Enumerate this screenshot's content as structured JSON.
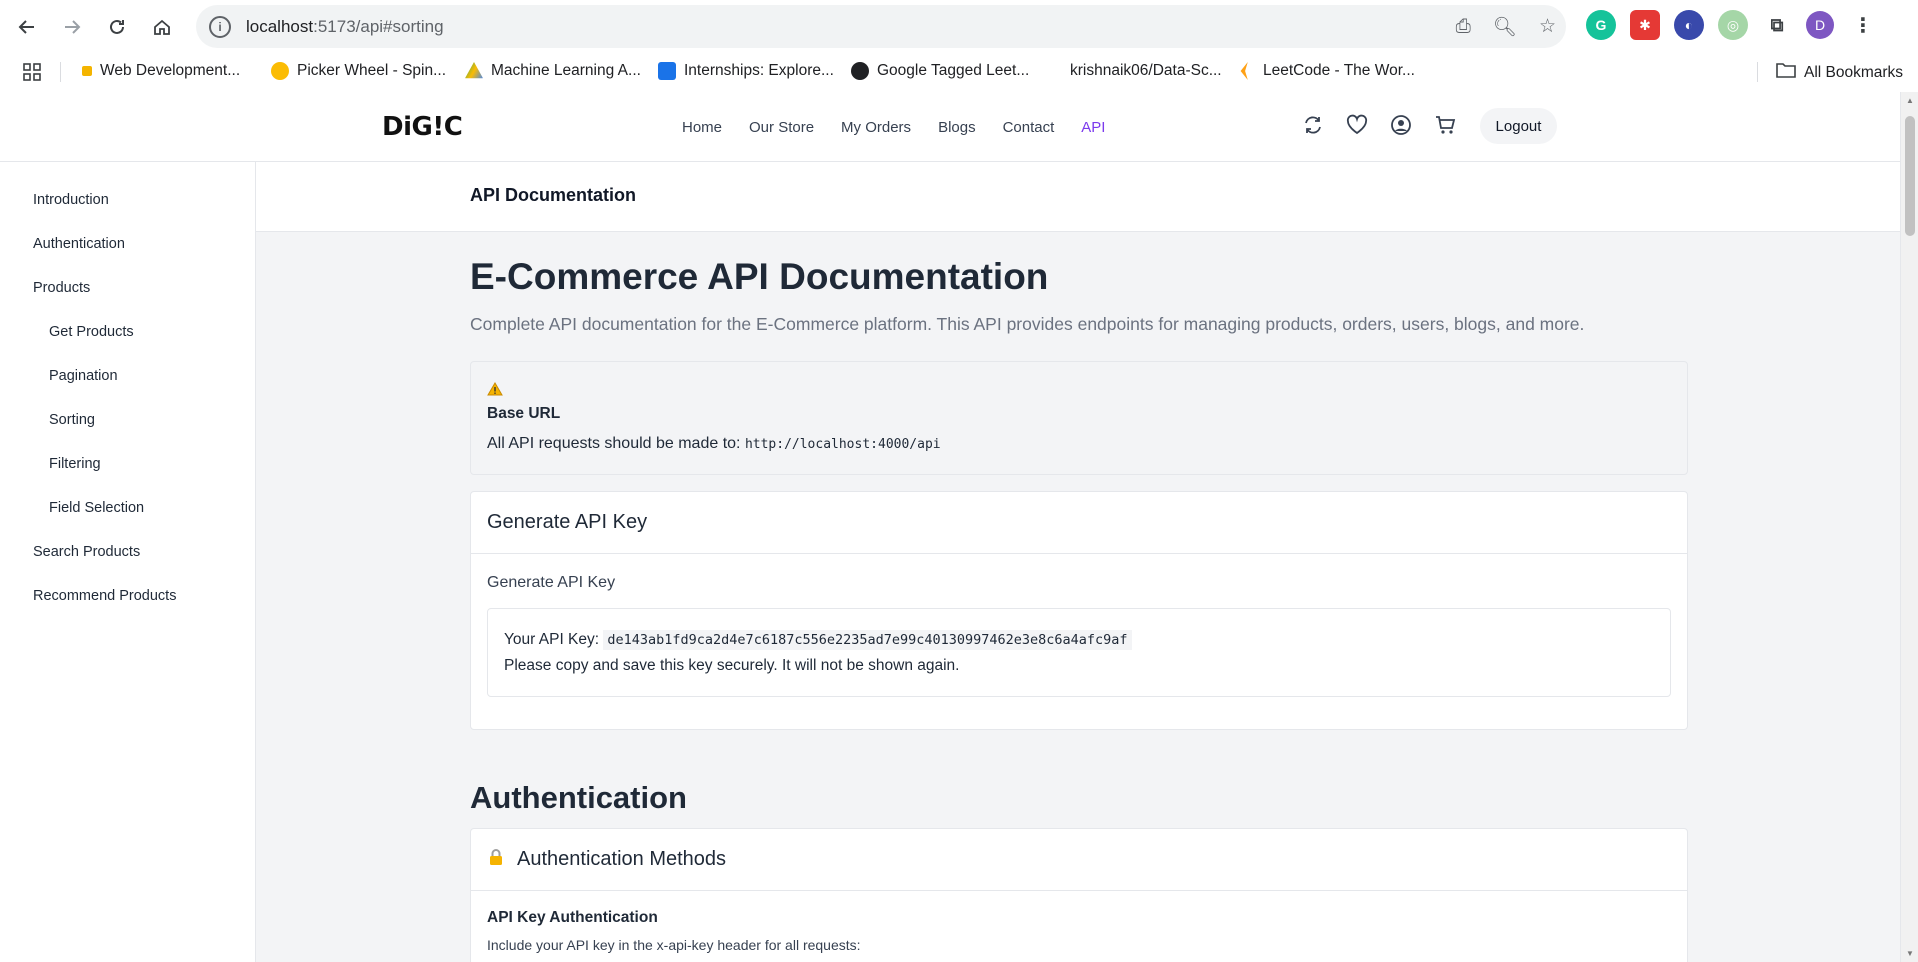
{
  "browser": {
    "url_host": "localhost",
    "url_path": ":5173/api#sorting",
    "bookmarks": [
      {
        "label": "Web Development...",
        "color": "#f4b400"
      },
      {
        "label": "Picker Wheel - Spin...",
        "color": "#fbbc04"
      },
      {
        "label": "Machine Learning A...",
        "color": "#34a853"
      },
      {
        "label": "Internships: Explore...",
        "color": "#1a73e8"
      },
      {
        "label": "Google Tagged Leet...",
        "color": "#202124"
      },
      {
        "label": "krishnaik06/Data-Sc...",
        "color": "#ffffff"
      },
      {
        "label": "LeetCode - The Wor...",
        "color": "#ffa116"
      }
    ],
    "all_bookmarks": "All Bookmarks",
    "profile_initial": "D"
  },
  "site": {
    "logo": "DiG!C",
    "nav": [
      {
        "label": "Home",
        "active": false
      },
      {
        "label": "Our Store",
        "active": false
      },
      {
        "label": "My Orders",
        "active": false
      },
      {
        "label": "Blogs",
        "active": false
      },
      {
        "label": "Contact",
        "active": false
      },
      {
        "label": "API",
        "active": true
      }
    ],
    "logout": "Logout",
    "accent": "#7c3aed"
  },
  "sidebar": {
    "items": [
      {
        "label": "Introduction",
        "sub": false
      },
      {
        "label": "Authentication",
        "sub": false
      },
      {
        "label": "Products",
        "sub": false
      },
      {
        "label": "Get Products",
        "sub": true
      },
      {
        "label": "Pagination",
        "sub": true
      },
      {
        "label": "Sorting",
        "sub": true
      },
      {
        "label": "Filtering",
        "sub": true
      },
      {
        "label": "Field Selection",
        "sub": true
      },
      {
        "label": "Search Products",
        "sub": false
      },
      {
        "label": "Recommend Products",
        "sub": false
      }
    ]
  },
  "doc": {
    "bar_title": "API Documentation",
    "title": "E-Commerce API Documentation",
    "lead": "Complete API documentation for the E-Commerce platform. This API provides endpoints for managing products, orders, users, blogs, and more.",
    "base_url": {
      "title": "Base URL",
      "desc": "All API requests should be made to:",
      "url": "http://localhost:4000/api"
    },
    "api_key": {
      "card_title": "Generate API Key",
      "label": "Generate API Key",
      "key_label": "Your API Key:",
      "key": "de143ab1fd9ca2d4e7c6187c556e2235ad7e99c40130997462e3e8c6a4afc9af",
      "note": "Please copy and save this key securely. It will not be shown again."
    },
    "auth": {
      "heading": "Authentication",
      "card_title": "Authentication Methods",
      "sub_title": "API Key Authentication",
      "sub_desc": "Include your API key in the x-api-key header for all requests:"
    }
  }
}
